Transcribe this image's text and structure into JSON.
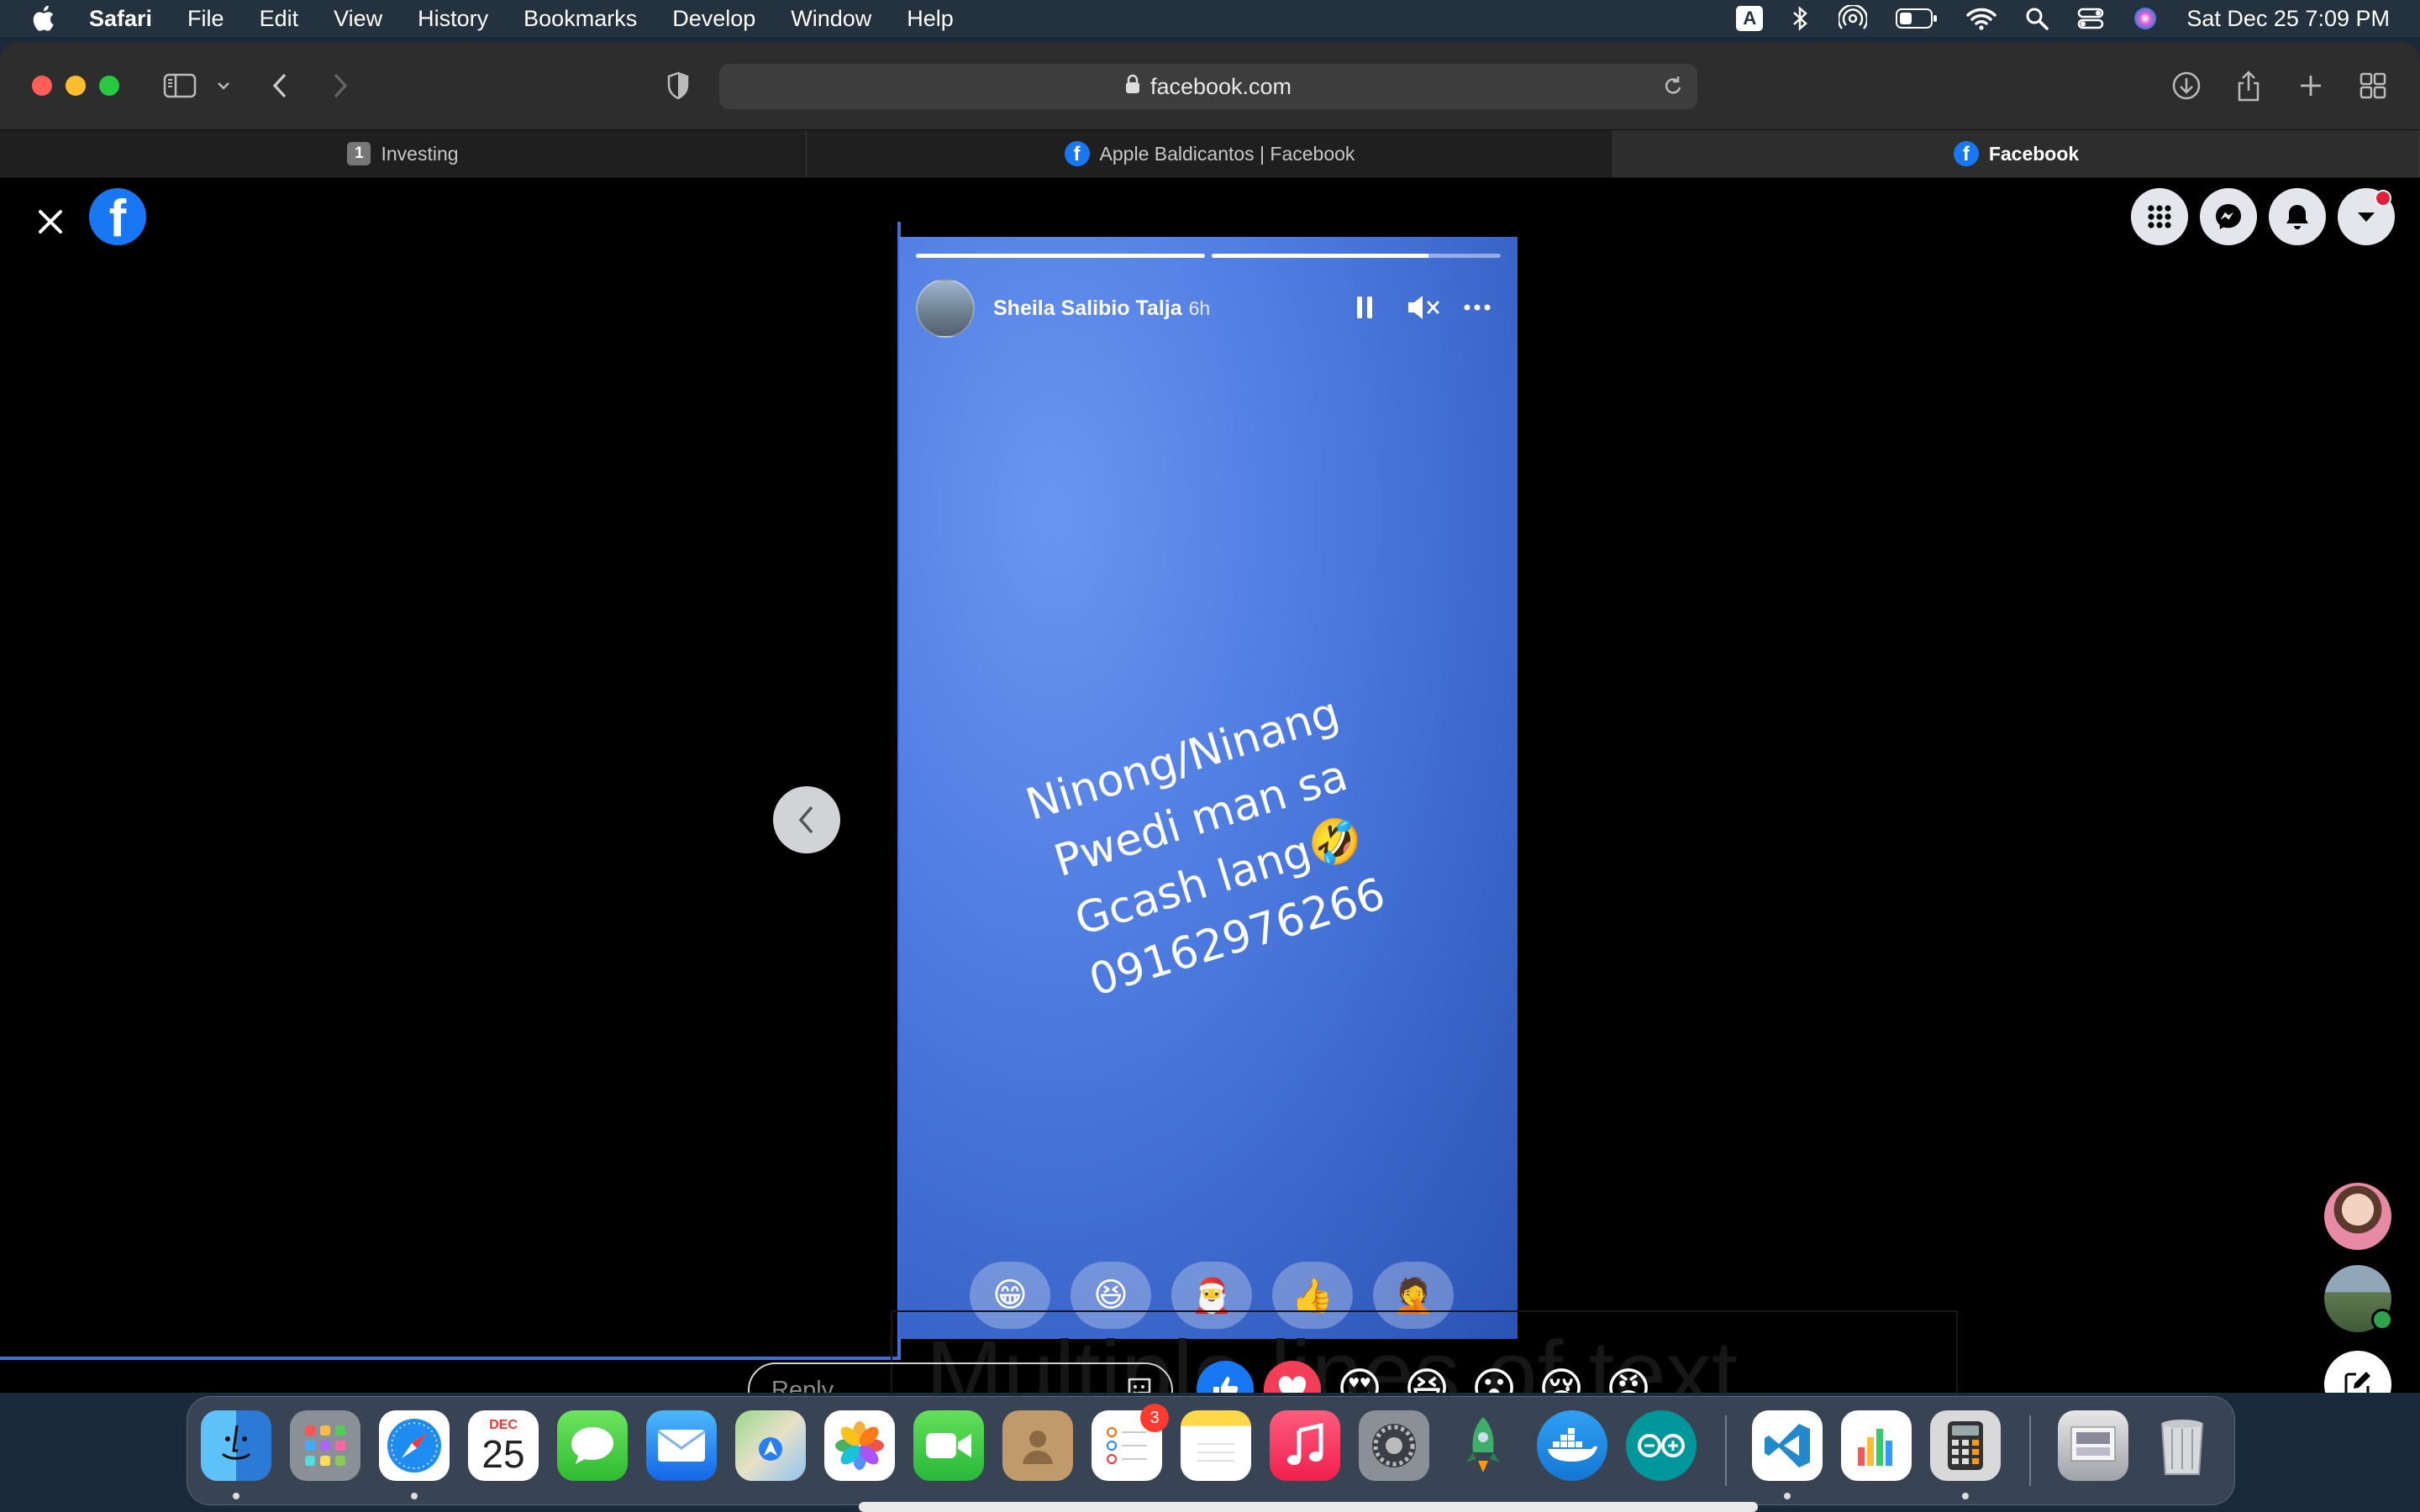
{
  "menubar": {
    "app_name": "Safari",
    "menus": [
      "File",
      "Edit",
      "View",
      "History",
      "Bookmarks",
      "Develop",
      "Window",
      "Help"
    ],
    "input_source": "A",
    "clock": "Sat Dec 25  7:09 PM"
  },
  "browser": {
    "url": "facebook.com",
    "tabs": [
      {
        "label": "Investing",
        "badge": "1"
      },
      {
        "label": "Apple Baldicantos | Facebook"
      },
      {
        "label": "Facebook"
      }
    ]
  },
  "story": {
    "author": "Sheila Salibio Talja",
    "age": "6h",
    "progress": [
      1.0,
      0.75
    ],
    "text_lines": [
      "Ninong/Ninang",
      "Pwedi man sa",
      "Gcash lang🤣",
      "09162976266"
    ],
    "quick_reactions": [
      "😁",
      "😆",
      "🎅",
      "👍",
      "🤦"
    ]
  },
  "reply": {
    "placeholder": "Reply..."
  },
  "reaction_bar": [
    "👍",
    "❤",
    "😍",
    "😆",
    "😮",
    "😢",
    "😡"
  ],
  "faint_overlay_text": "Multiple lines of text",
  "dock": {
    "calendar_month": "DEC",
    "calendar_day": "25",
    "reminders_badge": "3"
  },
  "colors": {
    "facebook_blue": "#1877f2",
    "story_bg": "#4a78dd",
    "notification_red": "#e41e3f"
  }
}
